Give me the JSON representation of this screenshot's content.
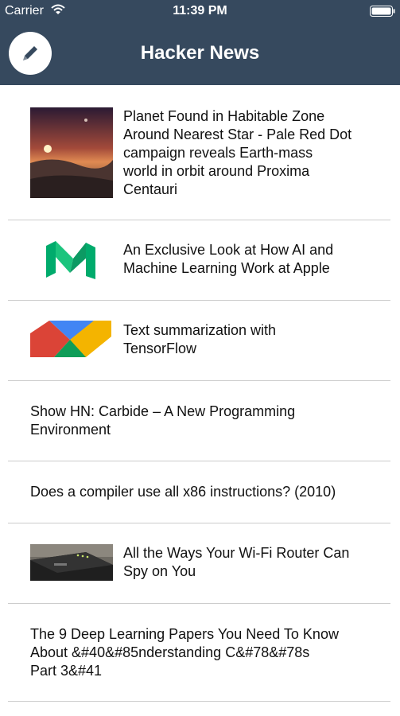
{
  "status_bar": {
    "carrier": "Carrier",
    "time": "11:39 PM"
  },
  "header": {
    "title": "Hacker News"
  },
  "stories": [
    {
      "title": "Planet Found in Habitable Zone\nAround Nearest Star - Pale Red Dot\ncampaign reveals Earth-mass\nworld in orbit around Proxima\nCentauri",
      "thumbnail": "proxima-planet-image"
    },
    {
      "title": "An Exclusive Look at How AI and\nMachine Learning Work at Apple",
      "thumbnail": "medium-logo"
    },
    {
      "title": "Text summarization with\nTensorFlow",
      "thumbnail": "google-logo-image"
    },
    {
      "title": "Show HN: Carbide – A New Programming\nEnvironment"
    },
    {
      "title": "Does a compiler use all x86 instructions? (2010)"
    },
    {
      "title": "All the Ways Your Wi-Fi Router Can\nSpy on You",
      "thumbnail": "wifi-router-image"
    },
    {
      "title": "The 9 Deep Learning Papers You Need To Know\nAbout &#40&#85nderstanding C&#78&#78s\nPart 3&#41"
    }
  ],
  "colors": {
    "header_bg": "#36495e",
    "divider": "#cccccc",
    "text": "#111111"
  }
}
